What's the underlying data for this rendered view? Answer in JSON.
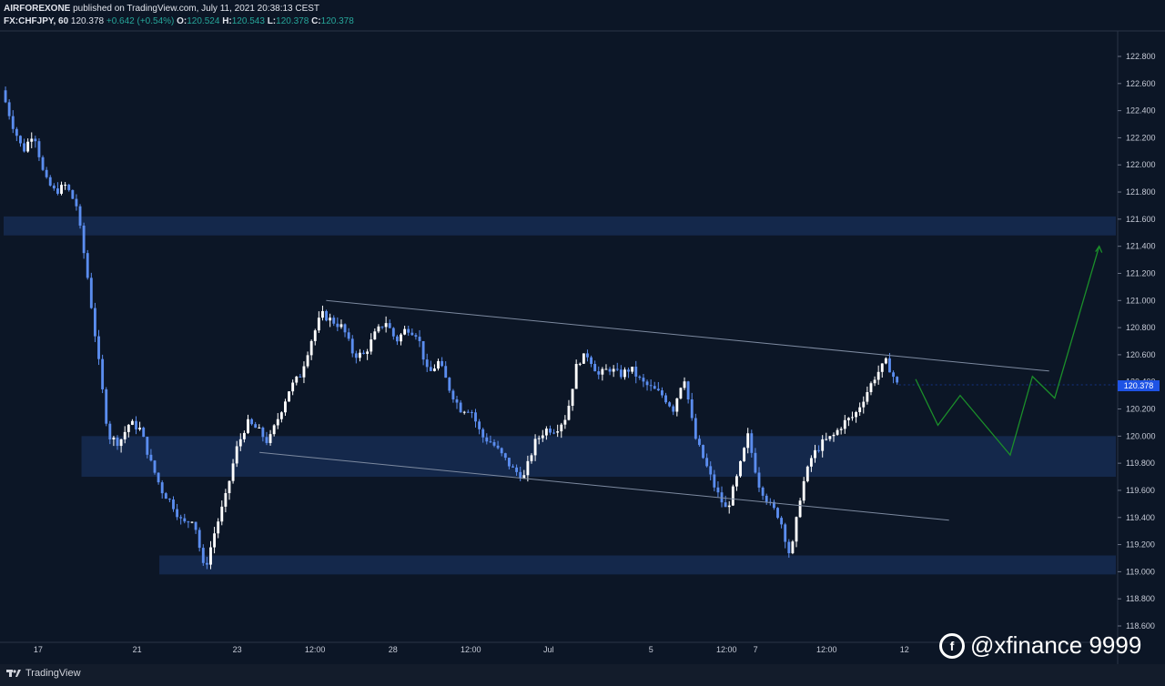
{
  "header": {
    "author": "AIRFOREXONE",
    "published_text": "published on TradingView.com, July 11, 2021 20:38:13 CEST",
    "symbol": "FX:CHFJPY, 60",
    "last": "120.378",
    "change": "+0.642 (+0.54%)",
    "o_label": "O:",
    "o_value": "120.524",
    "h_label": "H:",
    "h_value": "120.543",
    "l_label": "L:",
    "l_value": "120.378",
    "c_label": "C:",
    "c_value": "120.378"
  },
  "footer": {
    "logo_text": "TradingView"
  },
  "watermark": {
    "text": "@xfinance 9999"
  },
  "colors": {
    "background": "#0c1626",
    "candle": "#5b8def",
    "candle_light": "#ffffff",
    "zone": "#162c52",
    "projection": "#1b8f2a",
    "channel": "#7d8aa0",
    "price_tag": "#1e53e5"
  },
  "chart_data": {
    "type": "candlestick",
    "symbol": "FX:CHFJPY",
    "interval": "60",
    "ylim": [
      118.5,
      122.9
    ],
    "y_ticks": [
      "122.800",
      "122.600",
      "122.400",
      "122.200",
      "122.000",
      "121.800",
      "121.600",
      "121.400",
      "121.200",
      "121.000",
      "120.800",
      "120.600",
      "120.400",
      "120.200",
      "120.000",
      "119.800",
      "119.600",
      "119.400",
      "119.200",
      "119.000",
      "118.800",
      "118.600"
    ],
    "x_ticks": [
      "17",
      "21",
      "23",
      "12:00",
      "28",
      "12:00",
      "Jul",
      "5",
      "12:00",
      "7",
      "12:00",
      "12"
    ],
    "last_price_label": "120.378",
    "price_path": [
      122.55,
      122.3,
      122.1,
      122.25,
      121.9,
      121.8,
      121.85,
      121.7,
      121.2,
      120.6,
      120.0,
      119.95,
      120.1,
      120.05,
      119.8,
      119.6,
      119.5,
      119.35,
      119.4,
      119.0,
      119.3,
      119.55,
      119.9,
      120.1,
      120.05,
      119.95,
      120.15,
      120.35,
      120.45,
      120.7,
      120.9,
      120.85,
      120.8,
      120.6,
      120.6,
      120.75,
      120.85,
      120.7,
      120.8,
      120.75,
      120.45,
      120.55,
      120.35,
      120.2,
      120.2,
      120.0,
      119.95,
      119.85,
      119.75,
      119.7,
      119.95,
      120.05,
      120.05,
      120.15,
      120.55,
      120.6,
      120.45,
      120.5,
      120.45,
      120.5,
      120.4,
      120.35,
      120.3,
      120.2,
      120.45,
      120.0,
      119.8,
      119.6,
      119.45,
      119.7,
      120.0,
      119.65,
      119.5,
      119.4,
      119.1,
      119.6,
      119.85,
      119.95,
      120.0,
      120.1,
      120.15,
      120.3,
      120.45,
      120.55,
      120.38
    ],
    "zones": [
      {
        "from": 121.48,
        "to": 121.62
      },
      {
        "from": 119.7,
        "to": 120.0
      },
      {
        "from": 118.98,
        "to": 119.12
      }
    ],
    "channel_upper": {
      "from": [
        0.29,
        121.0
      ],
      "to": [
        0.94,
        120.48
      ]
    },
    "channel_lower": {
      "from": [
        0.23,
        119.88
      ],
      "to": [
        0.85,
        119.38
      ]
    },
    "projection_path": [
      [
        0.82,
        120.42
      ],
      [
        0.84,
        120.08
      ],
      [
        0.86,
        120.3
      ],
      [
        0.905,
        119.86
      ],
      [
        0.925,
        120.44
      ],
      [
        0.945,
        120.28
      ],
      [
        0.985,
        121.4
      ]
    ]
  }
}
